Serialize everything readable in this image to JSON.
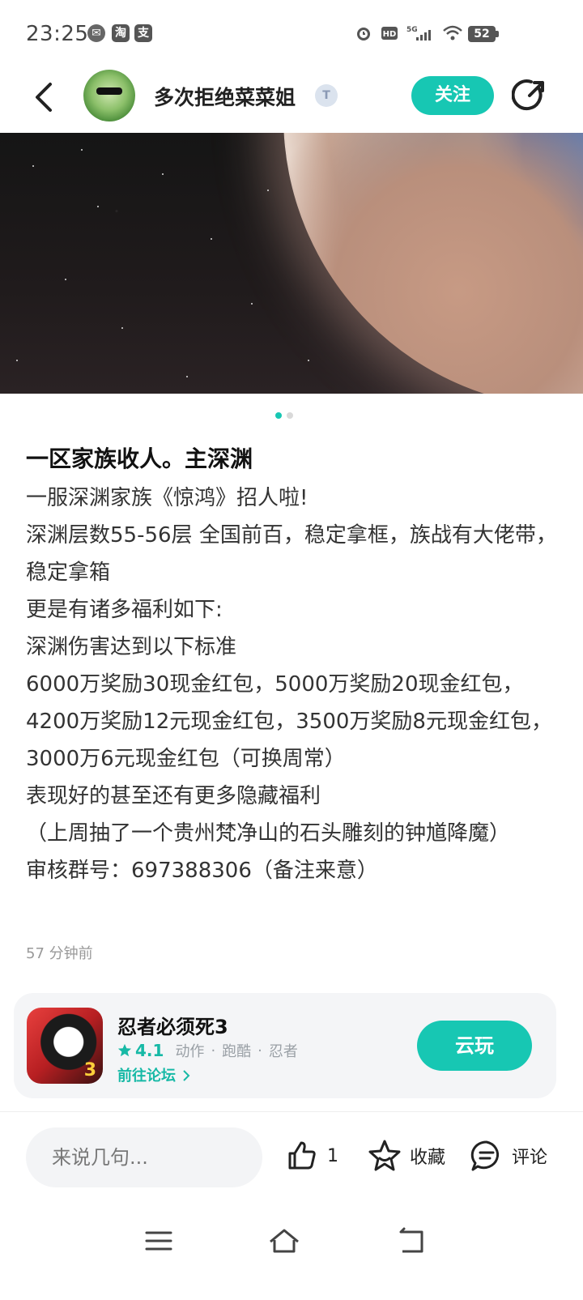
{
  "status_bar": {
    "time": "23:25",
    "notification_icons": [
      "wechat-icon",
      "taobao-icon",
      "alipay-icon"
    ],
    "right_icons": [
      "alarm-icon",
      "hd-icon",
      "5g-signal-icon",
      "wifi-icon"
    ],
    "battery": "52"
  },
  "header": {
    "username": "多次拒绝菜菜姐",
    "level_badge": "T",
    "follow_label": "关注"
  },
  "carousel": {
    "pages": 2,
    "active_index": 0
  },
  "post": {
    "title": "一区家族收人。主深渊",
    "lines": [
      "一服深渊家族《惊鸿》招人啦!",
      "深渊层数55-56层  全国前百，稳定拿框，族战有大佬带，稳定拿箱",
      "更是有诸多福利如下:",
      "深渊伤害达到以下标准",
      "6000万奖励30现金红包，5000万奖励20现金红包，4200万奖励12元现金红包，3500万奖励8元现金红包，3000万6元现金红包（可换周常）",
      "表现好的甚至还有更多隐藏福利",
      "（上周抽了一个贵州梵净山的石头雕刻的钟馗降魔）",
      "审核群号：697388306（备注来意）"
    ],
    "time_ago": "57 分钟前"
  },
  "game_card": {
    "name": "忍者必须死3",
    "rating": "4.1",
    "tags": [
      "动作",
      "跑酷",
      "忍者"
    ],
    "tag_separator": "·",
    "forum_link": "前往论坛",
    "play_button": "云玩",
    "icon_number": "3"
  },
  "bottom_bar": {
    "comment_placeholder": "来说几句...",
    "like_count": "1",
    "favorite_label": "收藏",
    "comment_label": "评论"
  },
  "colors": {
    "accent": "#17c7b3",
    "accent_text": "#17b9a6"
  }
}
